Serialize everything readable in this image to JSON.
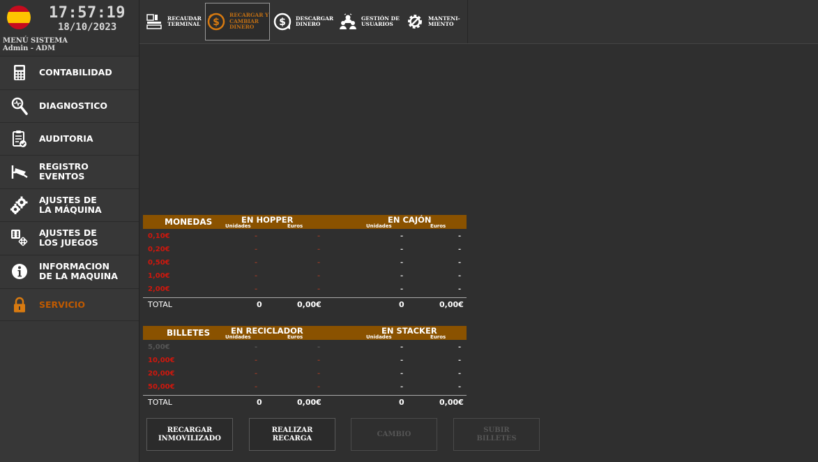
{
  "header": {
    "time": "17:57:19",
    "date": "18/10/2023",
    "menu_title": "MENÚ SISTEMA",
    "user": "Admin - ADM"
  },
  "sidebar": {
    "items": [
      {
        "label": "CONTABILIDAD",
        "icon": "calculator-icon"
      },
      {
        "label": "DIAGNOSTICO",
        "icon": "magnifier-icon"
      },
      {
        "label": "AUDITORIA",
        "icon": "clipboard-icon"
      },
      {
        "label": "REGISTRO\nEVENTOS",
        "icon": "camera-icon"
      },
      {
        "label": "AJUSTES DE\nLA MÁQUINA",
        "icon": "gears-icon"
      },
      {
        "label": "AJUSTES DE\nLOS JUEGOS",
        "icon": "dice-icon"
      },
      {
        "label": "INFORMACION\nDE LA MAQUINA",
        "icon": "info-icon"
      },
      {
        "label": "SERVICIO",
        "icon": "lock-icon"
      }
    ]
  },
  "toolbar": {
    "buttons": [
      {
        "label": "RECAUDAR\nTERMINAL",
        "icon": "terminal-icon"
      },
      {
        "label": "RECARGAR Y\nCAMBIAR\nDINERO",
        "icon": "coin-refresh-icon"
      },
      {
        "label": "DESCARGAR\nDINERO",
        "icon": "coin-download-icon"
      },
      {
        "label": "GESTIÓN DE\nUSUARIOS",
        "icon": "users-icon"
      },
      {
        "label": "MANTENI-\nMIENTO",
        "icon": "gear-wrench-icon"
      }
    ]
  },
  "monedas": {
    "title": "MONEDAS",
    "sec1": "EN HOPPER",
    "sec2": "EN CAJÓN",
    "sub_units": "Unidades",
    "sub_euros": "Euros",
    "rows": [
      {
        "label": "0,10€",
        "h_u": "-",
        "h_e": "-",
        "c_u": "-",
        "c_e": "-"
      },
      {
        "label": "0,20€",
        "h_u": "-",
        "h_e": "-",
        "c_u": "-",
        "c_e": "-"
      },
      {
        "label": "0,50€",
        "h_u": "-",
        "h_e": "-",
        "c_u": "-",
        "c_e": "-"
      },
      {
        "label": "1,00€",
        "h_u": "-",
        "h_e": "-",
        "c_u": "-",
        "c_e": "-"
      },
      {
        "label": "2,00€",
        "h_u": "-",
        "h_e": "-",
        "c_u": "-",
        "c_e": "-"
      }
    ],
    "total": {
      "label": "TOTAL",
      "h_u": "0",
      "h_e": "0,00€",
      "c_u": "0",
      "c_e": "0,00€"
    }
  },
  "billetes": {
    "title": "BILLETES",
    "sec1": "EN RECICLADOR",
    "sec2": "EN STACKER",
    "sub_units": "Unidades",
    "sub_euros": "Euros",
    "rows": [
      {
        "label": "5,00€",
        "h_u": "-",
        "h_e": "-",
        "c_u": "-",
        "c_e": "-"
      },
      {
        "label": "10,00€",
        "h_u": "-",
        "h_e": "-",
        "c_u": "-",
        "c_e": "-"
      },
      {
        "label": "20,00€",
        "h_u": "-",
        "h_e": "-",
        "c_u": "-",
        "c_e": "-"
      },
      {
        "label": "50,00€",
        "h_u": "-",
        "h_e": "-",
        "c_u": "-",
        "c_e": "-"
      }
    ],
    "total": {
      "label": "TOTAL",
      "h_u": "0",
      "h_e": "0,00€",
      "c_u": "0",
      "c_e": "0,00€"
    }
  },
  "actions": {
    "recargar_inmovilizado": "RECARGAR\nINMOVILIZADO",
    "realizar_recarga": "REALIZAR\nRECARGA",
    "cambio": "CAMBIO",
    "subir_billetes": "SUBIR\nBILLETES"
  },
  "colors": {
    "accent": "#8a5200",
    "active": "#c26f12",
    "denomination_red": "#d0170d"
  }
}
